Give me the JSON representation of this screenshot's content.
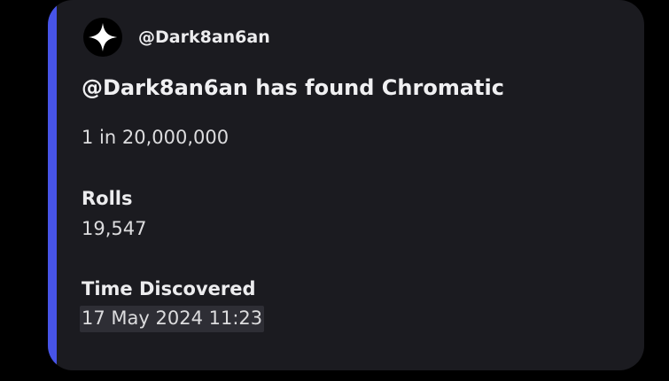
{
  "embed": {
    "accent_color": "#4754e8",
    "author": {
      "icon": "sparkle-icon",
      "name": "@Dark8an6an"
    },
    "title": "@Dark8an6an has found Chromatic",
    "description": "1 in 20,000,000",
    "fields": [
      {
        "name": "Rolls",
        "value": "19,547"
      },
      {
        "name": "Time Discovered",
        "value": "17 May 2024 11:23"
      }
    ]
  }
}
